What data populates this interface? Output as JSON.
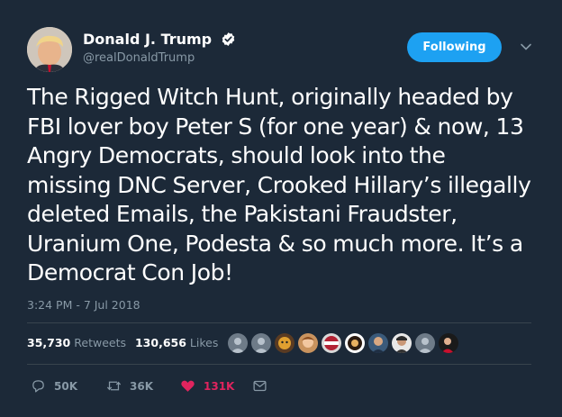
{
  "author": {
    "display_name": "Donald J. Trump",
    "handle": "@realDonaldTrump",
    "verified_icon": "verified-badge-icon"
  },
  "follow_button": {
    "label": "Following",
    "color": "#1da1f2"
  },
  "menu_icon": "chevron-down-icon",
  "tweet": {
    "lines": [
      "The Rigged Witch Hunt, originally headed by",
      "FBI lover boy Peter S (for one year) & now, 13",
      "Angry Democrats, should look into the",
      "missing DNC Server, Crooked Hillary’s illegally",
      "deleted Emails, the Pakistani Fraudster,",
      "Uranium One, Podesta & so much more. It’s a",
      "Democrat Con Job!"
    ],
    "timestamp": "3:24 PM - 7 Jul 2018"
  },
  "stats": {
    "retweets_count": "35,730",
    "retweets_label": "Retweets",
    "likes_count": "130,656",
    "likes_label": "Likes"
  },
  "likers": [
    "avatar-1",
    "avatar-2",
    "avatar-3",
    "avatar-4",
    "avatar-5",
    "avatar-6",
    "avatar-7",
    "avatar-8",
    "avatar-9",
    "avatar-10"
  ],
  "actions": {
    "reply": {
      "icon": "reply-icon",
      "count": "50K"
    },
    "retweet": {
      "icon": "retweet-icon",
      "count": "36K"
    },
    "like": {
      "icon": "heart-icon",
      "count": "131K",
      "color": "#e0245e"
    },
    "message": {
      "icon": "envelope-icon"
    }
  },
  "colors": {
    "background": "#1c2938",
    "secondary_text": "#8899a6",
    "divider": "#38444d"
  }
}
